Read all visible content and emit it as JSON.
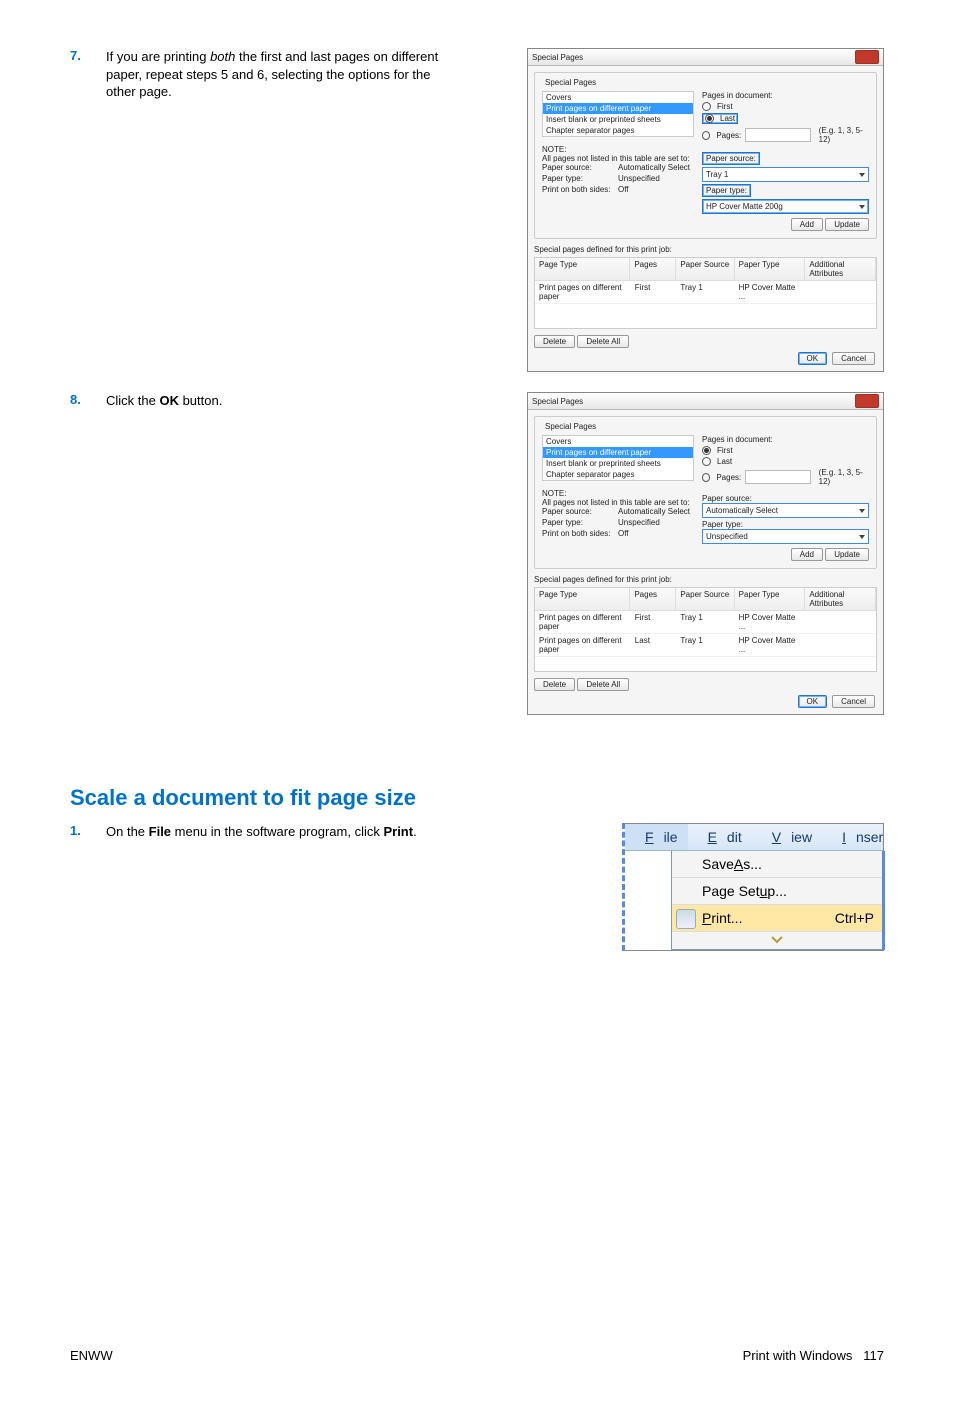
{
  "steps": {
    "s7": {
      "num": "7.",
      "text_before": "If you are printing ",
      "text_italic": "both",
      "text_after": " the first and last pages on different paper, repeat steps 5 and 6, selecting the options for the other page."
    },
    "s8": {
      "num": "8.",
      "text_before": "Click the ",
      "text_bold": "OK",
      "text_after": " button."
    },
    "s1": {
      "num": "1.",
      "text_before": "On the ",
      "text_bold1": "File",
      "text_mid": " menu in the software program, click ",
      "text_bold2": "Print",
      "text_after": "."
    }
  },
  "section_title": "Scale a document to fit page size",
  "dialog1": {
    "title": "Special Pages",
    "group_title": "Special Pages",
    "list": {
      "i0": "Covers",
      "i1_sel": "Print pages on different paper",
      "i2": "Insert blank or preprinted sheets",
      "i3": "Chapter separator pages"
    },
    "note_head": "NOTE:",
    "note_body": "All pages not listed in this table are set to:",
    "rows": {
      "paper_source_lbl": "Paper source:",
      "paper_source_val": "Automatically Select",
      "paper_type_lbl": "Paper type:",
      "paper_type_val": "Unspecified",
      "both_sides_lbl": "Print on both sides:",
      "both_sides_val": "Off"
    },
    "right": {
      "pages_in_doc": "Pages in document:",
      "first": "First",
      "last": "Last",
      "pages": "Pages:",
      "eg": "(E.g. 1, 3, 5-12)",
      "paper_source_lbl": "Paper source:",
      "paper_source_val": "Tray 1",
      "paper_type_lbl": "Paper type:",
      "paper_type_val": "HP Cover Matte 200g",
      "add": "Add",
      "update": "Update"
    },
    "table_title": "Special pages defined for this print job:",
    "thead": {
      "c1": "Page Type",
      "c2": "Pages",
      "c3": "Paper Source",
      "c4": "Paper Type",
      "c5": "Additional Attributes"
    },
    "trow1": {
      "c1": "Print pages on different paper",
      "c2": "First",
      "c3": "Tray 1",
      "c4": "HP Cover Matte ...",
      "c5": ""
    },
    "delete": "Delete",
    "delete_all": "Delete All",
    "ok": "OK",
    "cancel": "Cancel"
  },
  "dialog2": {
    "title": "Special Pages",
    "group_title": "Special Pages",
    "list": {
      "i0": "Covers",
      "i1_sel": "Print pages on different paper",
      "i2": "Insert blank or preprinted sheets",
      "i3": "Chapter separator pages"
    },
    "note_head": "NOTE:",
    "note_body": "All pages not listed in this table are set to:",
    "rows": {
      "paper_source_lbl": "Paper source:",
      "paper_source_val": "Automatically Select",
      "paper_type_lbl": "Paper type:",
      "paper_type_val": "Unspecified",
      "both_sides_lbl": "Print on both sides:",
      "both_sides_val": "Off"
    },
    "right": {
      "pages_in_doc": "Pages in document:",
      "first": "First",
      "last": "Last",
      "pages": "Pages:",
      "eg": "(E.g. 1, 3, 5-12)",
      "paper_source_lbl": "Paper source:",
      "paper_source_val": "Automatically Select",
      "paper_type_lbl": "Paper type:",
      "paper_type_val": "Unspecified",
      "add": "Add",
      "update": "Update"
    },
    "table_title": "Special pages defined for this print job:",
    "thead": {
      "c1": "Page Type",
      "c2": "Pages",
      "c3": "Paper Source",
      "c4": "Paper Type",
      "c5": "Additional Attributes"
    },
    "trow1": {
      "c1": "Print pages on different paper",
      "c2": "First",
      "c3": "Tray 1",
      "c4": "HP Cover Matte ...",
      "c5": ""
    },
    "trow2": {
      "c1": "Print pages on different paper",
      "c2": "Last",
      "c3": "Tray 1",
      "c4": "HP Cover Matte ...",
      "c5": ""
    },
    "delete": "Delete",
    "delete_all": "Delete All",
    "ok": "OK",
    "cancel": "Cancel"
  },
  "menu": {
    "file": "File",
    "edit": "Edit",
    "view": "View",
    "insert": "Inser",
    "save_as": "Save As...",
    "page_setup": "Page Setup...",
    "print": "Print...",
    "print_short": "Ctrl+P"
  },
  "footer": {
    "left": "ENWW",
    "right_label": "Print with Windows",
    "right_page": "117"
  }
}
